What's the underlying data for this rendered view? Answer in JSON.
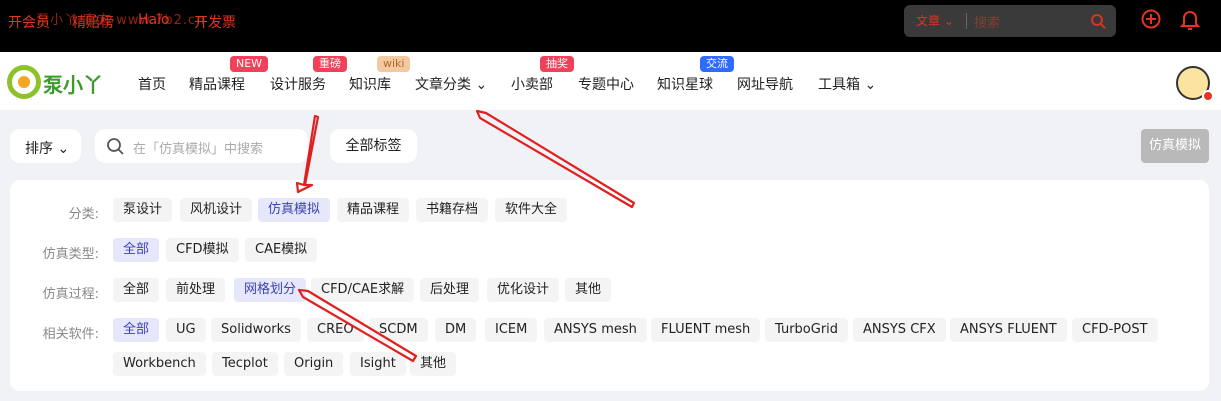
{
  "topbar": {
    "links": [
      "开会员",
      "精赔榜",
      "Halo",
      "开发票"
    ],
    "watermark": "泵小丫 官方 www.7b2.cn",
    "search_scope": "文章",
    "search_placeholder": "搜索"
  },
  "nav": {
    "brand": "泵小丫",
    "items": [
      "首页",
      "精品课程",
      "设计服务",
      "知识库",
      "文章分类",
      "小卖部",
      "专题中心",
      "知识星球",
      "网址导航",
      "工具箱"
    ],
    "badges": [
      "NEW",
      "重磅",
      "wiki",
      "抽奖",
      "交流"
    ]
  },
  "toolbar": {
    "sort_label": "排序",
    "search_placeholder": "在「仿真模拟」中搜索",
    "all_tags_label": "全部标签",
    "current_tag": "仿真模拟"
  },
  "filters": {
    "category": {
      "label": "分类:",
      "options": [
        "泵设计",
        "风机设计",
        "仿真模拟",
        "精品课程",
        "书籍存档",
        "软件大全"
      ],
      "selected": "仿真模拟"
    },
    "sim_type": {
      "label": "仿真类型:",
      "options": [
        "全部",
        "CFD模拟",
        "CAE模拟"
      ],
      "selected": "全部"
    },
    "sim_process": {
      "label": "仿真过程:",
      "options": [
        "全部",
        "前处理",
        "网格划分",
        "CFD/CAE求解",
        "后处理",
        "优化设计",
        "其他"
      ],
      "selected": "网格划分"
    },
    "software": {
      "label": "相关软件:",
      "options": [
        "全部",
        "UG",
        "Solidworks",
        "CREO",
        "SCDM",
        "DM",
        "ICEM",
        "ANSYS mesh",
        "FLUENT mesh",
        "TurboGrid",
        "ANSYS CFX",
        "ANSYS FLUENT",
        "CFD-POST",
        "Workbench",
        "Tecplot",
        "Origin",
        "Isight",
        "其他"
      ],
      "selected": "全部"
    }
  },
  "colors": {
    "accent_red": "#e2341e",
    "active_chip_bg": "#e6e7fb",
    "active_chip_text": "#3c44b1",
    "annotation_arrow": "#e02020"
  }
}
